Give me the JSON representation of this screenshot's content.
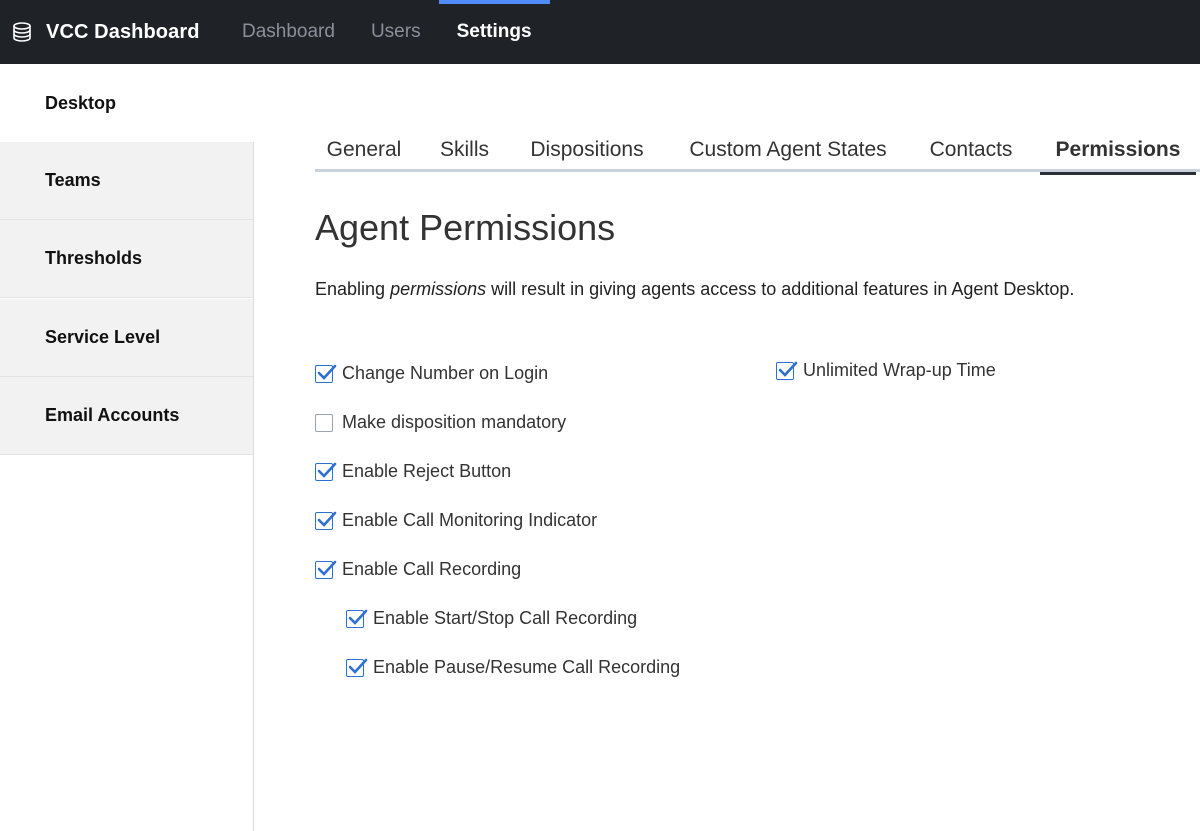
{
  "app": {
    "title": "VCC Dashboard",
    "logo_icon": "database-icon"
  },
  "nav": {
    "items": [
      {
        "label": "Dashboard",
        "active": false
      },
      {
        "label": "Users",
        "active": false
      },
      {
        "label": "Settings",
        "active": true
      }
    ],
    "accent_color": "#4f8cf7"
  },
  "sidebar": {
    "items": [
      {
        "label": "Desktop",
        "active": true
      },
      {
        "label": "Teams",
        "active": false
      },
      {
        "label": "Thresholds",
        "active": false
      },
      {
        "label": "Service Level",
        "active": false
      },
      {
        "label": "Email Accounts",
        "active": false
      }
    ]
  },
  "tabs": {
    "items": [
      {
        "label": "General",
        "active": false
      },
      {
        "label": "Skills",
        "active": false
      },
      {
        "label": "Dispositions",
        "active": false
      },
      {
        "label": "Custom Agent States",
        "active": false
      },
      {
        "label": "Contacts",
        "active": false
      },
      {
        "label": "Permissions",
        "active": true
      }
    ]
  },
  "main": {
    "title": "Agent Permissions",
    "desc_before": "Enabling ",
    "desc_em": "permissions",
    "desc_after": " will result in giving agents access to additional features in Agent Desktop."
  },
  "permissions": {
    "left": [
      {
        "label": "Change Number on Login",
        "checked": true,
        "indent": false
      },
      {
        "label": "Make disposition mandatory",
        "checked": false,
        "indent": false
      },
      {
        "label": "Enable Reject Button",
        "checked": true,
        "indent": false
      },
      {
        "label": "Enable Call Monitoring Indicator",
        "checked": true,
        "indent": false
      },
      {
        "label": "Enable Call Recording",
        "checked": true,
        "indent": false
      },
      {
        "label": "Enable Start/Stop Call Recording",
        "checked": true,
        "indent": true
      },
      {
        "label": "Enable Pause/Resume Call Recording",
        "checked": true,
        "indent": true
      }
    ],
    "right": [
      {
        "label": "Unlimited Wrap-up Time",
        "checked": true,
        "indent": false
      }
    ],
    "check_color": "#2d6fd2"
  }
}
